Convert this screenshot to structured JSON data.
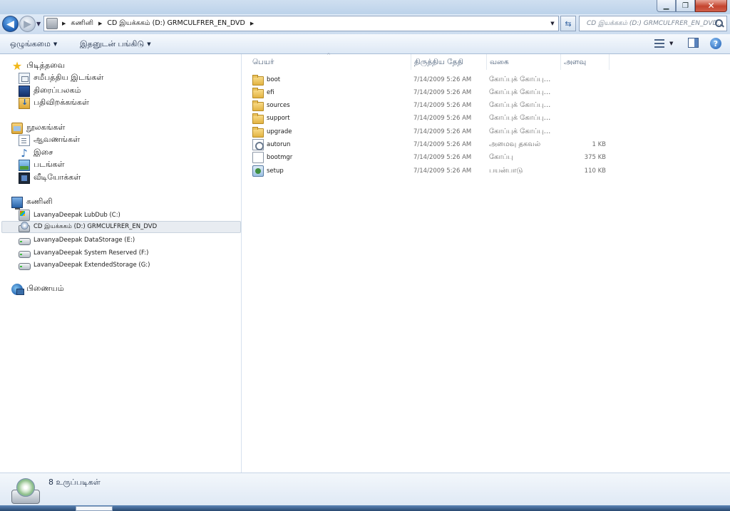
{
  "window": {
    "controls": {
      "minimize": "▁",
      "maximize": "❐",
      "close": "✕"
    }
  },
  "nav": {
    "back": "◀",
    "forward": "▶",
    "history_dropdown": "▼",
    "breadcrumb": [
      {
        "label": "கணினி"
      },
      {
        "label": "CD இயக்ககம்  (D:)  GRMCULFRER_EN_DVD"
      }
    ],
    "breadcrumb_separator": "▶",
    "address_dropdown": "▼",
    "refresh": "⇆",
    "search_placeholder": "CD இயக்ககம்  (D:)  GRMCULFRER_EN_DVD..."
  },
  "command_bar": {
    "organize": "ஒழுங்கமை",
    "share_with": "இதனுடன் பங்கிடு",
    "dropdown_arrow": "▼",
    "view_dropdown": "▼",
    "help": "?"
  },
  "navigation_pane": {
    "favorites": {
      "label": "பிடித்தவை",
      "items": [
        {
          "label": "சமீபத்திய இடங்கள்",
          "icon": "recent-places-icon"
        },
        {
          "label": "திரைப்பலகம்",
          "icon": "desktop-icon"
        },
        {
          "label": "பதிவிறக்கங்கள்",
          "icon": "downloads-icon"
        }
      ]
    },
    "libraries": {
      "label": "நூலகங்கள்",
      "items": [
        {
          "label": "ஆவணங்கள்",
          "icon": "documents-icon"
        },
        {
          "label": "இசை",
          "icon": "music-icon"
        },
        {
          "label": "படங்கள்",
          "icon": "pictures-icon"
        },
        {
          "label": "வீடியோக்கள்",
          "icon": "videos-icon"
        }
      ]
    },
    "computer": {
      "label": "கணினி",
      "items": [
        {
          "label": "LavanyaDeepak  LubDub  (C:)",
          "icon": "os-drive-icon"
        },
        {
          "label": "CD  இயக்ககம்  (D:)  GRMCULFRER_EN_DVD",
          "icon": "cd-drive-icon",
          "selected": true
        },
        {
          "label": "LavanyaDeepak  DataStorage  (E:)",
          "icon": "hard-drive-icon"
        },
        {
          "label": "LavanyaDeepak  System  Reserved  (F:)",
          "icon": "hard-drive-icon"
        },
        {
          "label": "LavanyaDeepak  ExtendedStorage  (G:)",
          "icon": "hard-drive-icon"
        }
      ]
    },
    "network": {
      "label": "பிணையம்"
    }
  },
  "file_list": {
    "sort_indicator": "^",
    "columns": {
      "name": "பெயர்",
      "date_modified": "திருத்திய தேதி",
      "type": "வகை",
      "size": "அளவு"
    },
    "rows": [
      {
        "name": "boot",
        "date": "7/14/2009  5:26  AM",
        "type": "கோப்புக் கோப்பு...",
        "size": "",
        "icon": "folder-icon"
      },
      {
        "name": "efi",
        "date": "7/14/2009  5:26  AM",
        "type": "கோப்புக் கோப்பு...",
        "size": "",
        "icon": "folder-icon"
      },
      {
        "name": "sources",
        "date": "7/14/2009  5:26  AM",
        "type": "கோப்புக் கோப்பு...",
        "size": "",
        "icon": "folder-icon"
      },
      {
        "name": "support",
        "date": "7/14/2009  5:26  AM",
        "type": "கோப்புக் கோப்பு...",
        "size": "",
        "icon": "folder-icon"
      },
      {
        "name": "upgrade",
        "date": "7/14/2009  5:26  AM",
        "type": "கோப்புக் கோப்பு...",
        "size": "",
        "icon": "folder-icon"
      },
      {
        "name": "autorun",
        "date": "7/14/2009  5:26  AM",
        "type": "அமைவு தகவல்",
        "size": "1  KB",
        "icon": "setup-info-icon"
      },
      {
        "name": "bootmgr",
        "date": "7/14/2009  5:26  AM",
        "type": "கோப்பு",
        "size": "375  KB",
        "icon": "file-icon"
      },
      {
        "name": "setup",
        "date": "7/14/2009  5:26  AM",
        "type": "பயன்பாடு",
        "size": "110  KB",
        "icon": "application-icon"
      }
    ]
  },
  "details_pane": {
    "item_count": "8  உருப்படிகள்"
  }
}
